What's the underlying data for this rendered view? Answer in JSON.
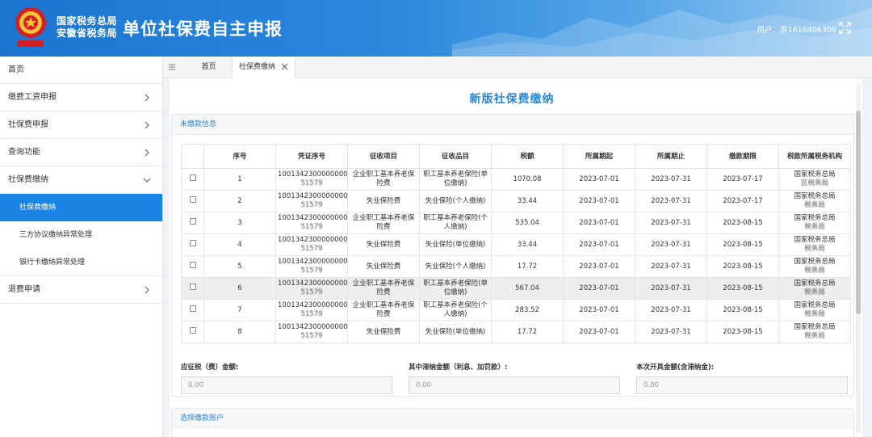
{
  "header": {
    "org_line1": "国家税务总局",
    "org_line2": "安徽省税务局",
    "title": "单位社保费自主申报",
    "user_label": "用户：",
    "user_name": "县1616406306"
  },
  "sidebar": {
    "items": [
      {
        "label": "首页"
      },
      {
        "label": "缴费工资申报"
      },
      {
        "label": "社保费申报"
      },
      {
        "label": "查询功能"
      },
      {
        "label": "社保费缴纳"
      },
      {
        "label": "社保费缴纳"
      },
      {
        "label": "三方协议缴纳异常处理"
      },
      {
        "label": "银行卡缴纳异常处理"
      },
      {
        "label": "退费申请"
      }
    ]
  },
  "tabs": {
    "home": "首页",
    "current": "社保费缴纳"
  },
  "page": {
    "title": "新版社保费缴纳"
  },
  "unpaid": {
    "section_title": "未缴款信息",
    "columns": [
      "序号",
      "凭证序号",
      "征收项目",
      "征收品目",
      "税额",
      "所属期起",
      "所属期止",
      "缴款期限",
      "税款所属税务机构"
    ],
    "rows": [
      {
        "no": "1",
        "voucher_a": "1001342300000000",
        "voucher_b": "51579",
        "item": "企业职工基本养老保险费",
        "subitem": "职工基本养老保险(单位缴纳)",
        "amount": "1070.08",
        "start": "2023-07-01",
        "end": "2023-07-31",
        "deadline": "2023-07-17",
        "org_a": "国家税务总局",
        "org_b": "区税务局"
      },
      {
        "no": "2",
        "voucher_a": "1001342300000000",
        "voucher_b": "51579",
        "item": "失业保险费",
        "subitem": "失业保险(个人缴纳)",
        "amount": "33.44",
        "start": "2023-07-01",
        "end": "2023-07-31",
        "deadline": "2023-07-17",
        "org_a": "国家税务总局",
        "org_b": "税务局"
      },
      {
        "no": "3",
        "voucher_a": "1001342300000000",
        "voucher_b": "51579",
        "item": "企业职工基本养老保险费",
        "subitem": "职工基本养老保险(个人缴纳)",
        "amount": "535.04",
        "start": "2023-07-01",
        "end": "2023-07-31",
        "deadline": "2023-08-15",
        "org_a": "国家税务总局",
        "org_b": "税务局"
      },
      {
        "no": "4",
        "voucher_a": "1001342300000000",
        "voucher_b": "51579",
        "item": "失业保险费",
        "subitem": "失业保险(单位缴纳)",
        "amount": "33.44",
        "start": "2023-07-01",
        "end": "2023-07-31",
        "deadline": "2023-08-15",
        "org_a": "国家税务总局",
        "org_b": "税务局"
      },
      {
        "no": "5",
        "voucher_a": "1001342300000000",
        "voucher_b": "51579",
        "item": "失业保险费",
        "subitem": "失业保险(个人缴纳)",
        "amount": "17.72",
        "start": "2023-07-01",
        "end": "2023-07-31",
        "deadline": "2023-08-15",
        "org_a": "国家税务总局",
        "org_b": "税务局"
      },
      {
        "no": "6",
        "voucher_a": "1001342300000000",
        "voucher_b": "51579",
        "item": "企业职工基本养老保险费",
        "subitem": "职工基本养老保险(单位缴纳)",
        "amount": "567.04",
        "start": "2023-07-01",
        "end": "2023-07-31",
        "deadline": "2023-08-15",
        "org_a": "国家税务总局",
        "org_b": "税务局"
      },
      {
        "no": "7",
        "voucher_a": "1001342300000000",
        "voucher_b": "51579",
        "item": "企业职工基本养老保险费",
        "subitem": "职工基本养老保险(个人缴纳)",
        "amount": "283.52",
        "start": "2023-07-01",
        "end": "2023-07-31",
        "deadline": "2023-08-15",
        "org_a": "国家税务总局",
        "org_b": "税务局"
      },
      {
        "no": "8",
        "voucher_a": "1001342300000000",
        "voucher_b": "51579",
        "item": "失业保险费",
        "subitem": "失业保险(单位缴纳)",
        "amount": "17.72",
        "start": "2023-07-01",
        "end": "2023-07-31",
        "deadline": "2023-08-15",
        "org_a": "国家税务总局",
        "org_b": "税务局"
      }
    ],
    "highlighted_row": 6
  },
  "summary": {
    "due_label": "应征税（费）金额:",
    "due_value": "0.00",
    "late_label": "其中滞纳金额（利息、加罚款）:",
    "late_value": "0.00",
    "issue_label": "本次开具金额(含滞纳金):",
    "issue_value": "0.00"
  },
  "account": {
    "section_title": "选择缴款账户"
  },
  "colors": {
    "header_blue": "#1b75d0",
    "accent_blue": "#2a87d8",
    "active_nav": "#1a84e4"
  }
}
